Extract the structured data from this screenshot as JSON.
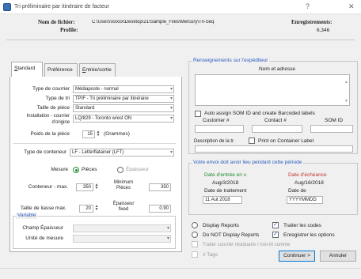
{
  "window": {
    "title": "Tri préliminaire par itinéraire de facteur",
    "help_label": "?",
    "close_label": "✕"
  },
  "header": {
    "filename_label": "Nom de fichier:",
    "filename_value": "C:\\Users\\xxxxx\\Desktop\\21\\Sample_Files\\Mercury\\Tri-Seq",
    "profile_label": "Profile:",
    "records_label": "Enregistrements:",
    "records_value": "6,346"
  },
  "tabs": [
    {
      "label": "Standard"
    },
    {
      "label": "Préférence"
    },
    {
      "label": "Entrée/sortie"
    }
  ],
  "standard": {
    "mail_type_label": "Type de courrier",
    "mail_type_value": "Médiaposte - normal",
    "sort_type_label": "Type de tri",
    "sort_type_value": "TPIF - Tri préliminaire par itinéraire",
    "piece_size_label": "Taille de pièce",
    "piece_size_value": "Standard",
    "install_label_1": "Installation - courrier",
    "install_label_2": "d'origine",
    "install_value": "LQ/829 - Toronto w/est ON",
    "weight_label": "Poids de la pièce",
    "weight_value": "15",
    "weight_unit": "(Grammes)",
    "container_type_label": "Type de conteneur",
    "container_type_value": "LF - Letterflatainer (LFT)",
    "measure_label": "Mesure",
    "measure_opt1": "Pièces",
    "measure_opt2": "Épaisseur",
    "container_max_label": "Conteneur - max.",
    "container_max_value": "350",
    "min_pieces_label_1": "Minimum",
    "min_pieces_label_2": "Pièces",
    "min_pieces_value": "350",
    "bundle_size_label": "Taille de liasse max.",
    "bundle_size_value": "20",
    "thickness_label_1": "Épaisseur",
    "thickness_label_2": "fixed",
    "thickness_value": "0.90",
    "variable_group": "Variable",
    "thickness_field_label": "Champ Épaisseur",
    "measure_unit_label": "Unité de mesure"
  },
  "shipper": {
    "group_title": "Renseignements sur l'expéditeur",
    "name_address_label": "Nom et adresse",
    "auto_assign_label": "Auto assign SOM ID and create Barcoded labels",
    "customer_label": "Customer #",
    "contact_label": "Contact #",
    "somid_label": "SOM ID",
    "desc_label": "Description de la tr.",
    "print_label_label": "Print on Container Label"
  },
  "dates": {
    "group_title": "Votre envoi doit avoir lieu pendant cette période",
    "start_label": "Date d'entrée en v.",
    "start_value": "Aug/3/2018",
    "expiry_label": "Date d'échéance",
    "expiry_value": "Aug/16/2018",
    "processing_label": "Date de traitement",
    "processing_value": "11 Aut 2018",
    "date_fmt_label": "Date de",
    "date_fmt_value": "YYYYMMDD"
  },
  "options": {
    "display_reports": "Display Reports",
    "no_display_reports": "Do NOT Display Reports",
    "process_codes": "Traiter les codes",
    "save_options": "Enregistrer les options",
    "process_mail_note": "Traiter courrier résiduaire / non-tri comme",
    "tags_label": "# Tags"
  },
  "buttons": {
    "continue_label": "Continuer >",
    "cancel_label": "Annuler"
  }
}
